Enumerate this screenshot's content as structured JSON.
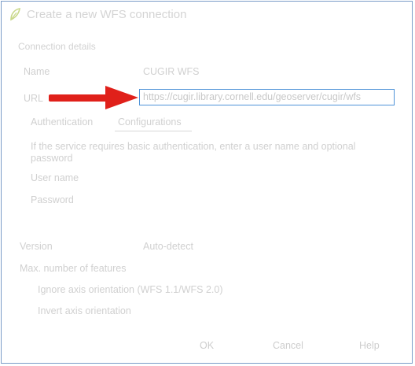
{
  "window": {
    "title": "Create a new WFS connection",
    "icon": "qgis-leaf-icon"
  },
  "section": {
    "title": "Connection details"
  },
  "fields": {
    "name_label": "Name",
    "name_value": "CUGIR WFS",
    "url_label": "URL",
    "url_value": "https://cugir.library.cornell.edu/geoserver/cugir/wfs"
  },
  "tabs": {
    "authentication": "Authentication",
    "configurations": "Configurations"
  },
  "auth": {
    "description": "If the service requires basic authentication, enter a user name and optional password",
    "username_label": "User name",
    "password_label": "Password"
  },
  "options": {
    "version_label": "Version",
    "version_value": "Auto-detect",
    "max_features_label": "Max. number of features",
    "ignore_axis_label": "Ignore axis orientation (WFS 1.1/WFS 2.0)",
    "invert_axis_label": "Invert axis orientation"
  },
  "buttons": {
    "ok": "OK",
    "cancel": "Cancel",
    "help": "Help"
  },
  "colors": {
    "arrow": "#e0201a",
    "field_focus_border": "#4f93d8",
    "window_border": "#7a9cc8"
  }
}
